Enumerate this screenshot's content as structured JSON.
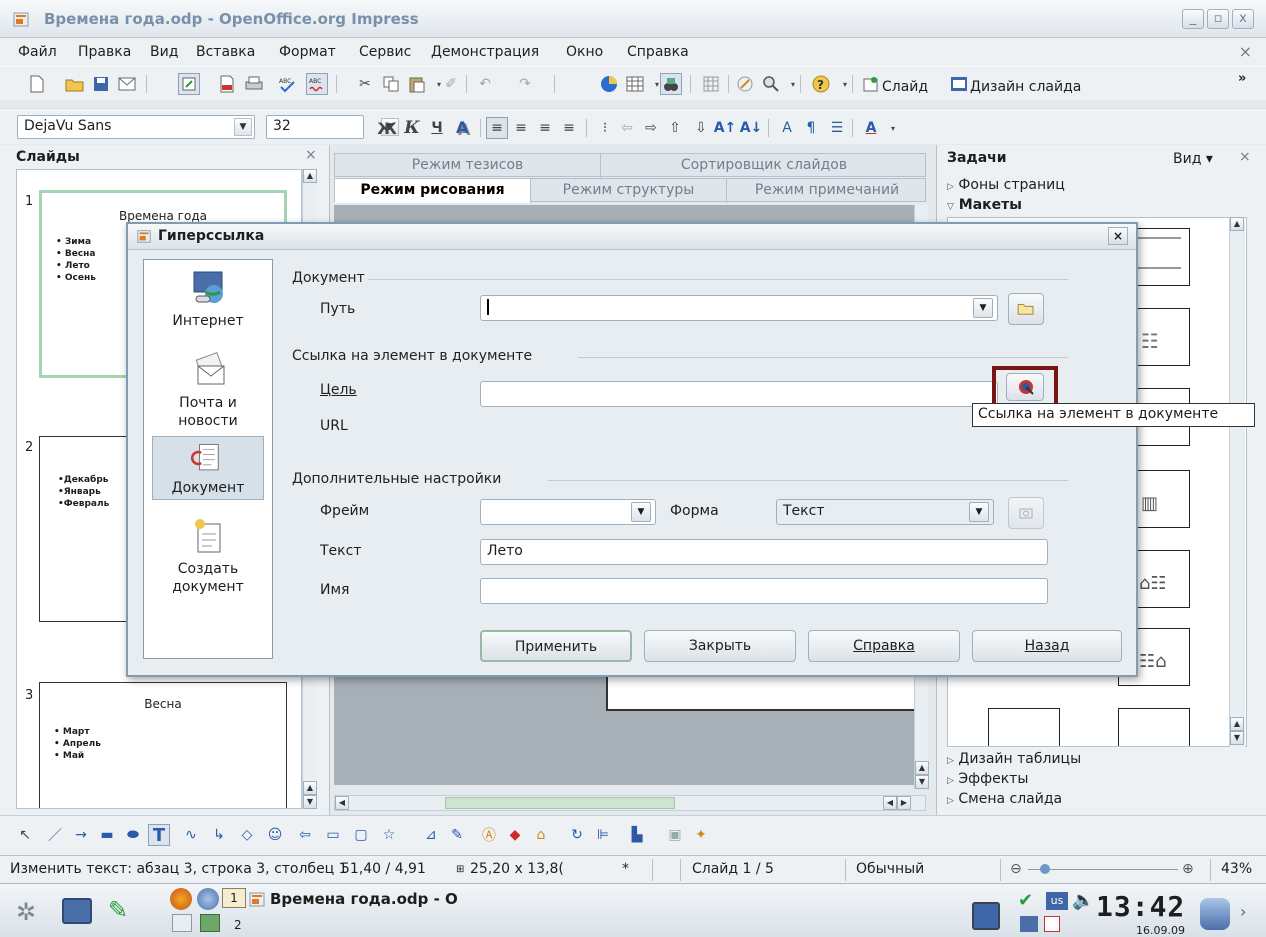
{
  "window": {
    "title": "Времена года.odp - OpenOffice.org Impress",
    "minimize": "_",
    "maximize": "▫",
    "close": "x"
  },
  "menu": {
    "items": [
      "Файл",
      "Правка",
      "Вид",
      "Вставка",
      "Формат",
      "Сервис",
      "Демонстрация",
      "Окно",
      "Справка"
    ],
    "doc_close": "×"
  },
  "toolbar": {
    "slide_label": "Слайд",
    "slide_design_label": "Дизайн слайда",
    "font_name": "DejaVu Sans",
    "font_size": "32",
    "bold": "Ж",
    "italic": "К",
    "underline": "Ч",
    "more": "»"
  },
  "slides_panel": {
    "title": "Слайды",
    "close": "×",
    "slides": [
      {
        "number": "1",
        "title": "Времена года",
        "bullets": [
          "• Зима",
          "• Весна",
          "• Лето",
          "• Осень"
        ]
      },
      {
        "number": "2",
        "title": "",
        "bullets": [
          "•Декабрь",
          "•Январь",
          "•Февраль"
        ]
      },
      {
        "number": "3",
        "title": "Весна",
        "bullets": [
          "• Март",
          "• Апрель",
          "• Май"
        ]
      }
    ]
  },
  "view_tabs": {
    "row1": [
      "Режим тезисов",
      "Сортировщик слайдов"
    ],
    "row2": [
      "Режим рисования",
      "Режим структуры",
      "Режим примечаний"
    ],
    "active": "Режим рисования"
  },
  "tasks_panel": {
    "title": "Задачи",
    "view_label": "Вид",
    "close": "×",
    "sections": [
      "Фоны страниц",
      "Макеты",
      "Дизайн таблицы",
      "Эффекты",
      "Смена слайда"
    ]
  },
  "statusbar": {
    "edit_text": "Изменить текст: абзац 3, строка 3, столбец 1",
    "position": "51,40 / 4,91",
    "size": "25,20 x 13,8(",
    "modified": "*",
    "slide": "Слайд 1 / 5",
    "layout": "Обычный",
    "zoom_minus": "⊖",
    "zoom_plus": "⊕",
    "zoom": "43%"
  },
  "taskbar": {
    "app_title": "Времена года.odp - O",
    "workspace1": "1",
    "workspace2": "2",
    "lang": "us",
    "time": "13:42",
    "date": "16.09.09"
  },
  "dialog": {
    "title": "Гиперссылка",
    "close": "×",
    "nav": [
      {
        "label": "Интернет"
      },
      {
        "label": "Почта и новости"
      },
      {
        "label": "Документ"
      },
      {
        "label": "Создать документ"
      }
    ],
    "selected_nav": "Документ",
    "document_group": "Документ",
    "path_label": "Путь",
    "path_value": "",
    "target_group": "Ссылка на элемент в документе",
    "target_label": "Цель",
    "target_value": "",
    "url_label": "URL",
    "more_group": "Дополнительные настройки",
    "frame_label": "Фрейм",
    "frame_value": "",
    "form_label": "Форма",
    "form_value": "Текст",
    "text_label": "Текст",
    "text_value": "Лето",
    "name_label": "Имя",
    "name_value": "",
    "buttons": {
      "apply": "Применить",
      "close": "Закрыть",
      "help": "Справка",
      "back": "Назад"
    },
    "tooltip": "Ссылка на элемент в документе"
  }
}
